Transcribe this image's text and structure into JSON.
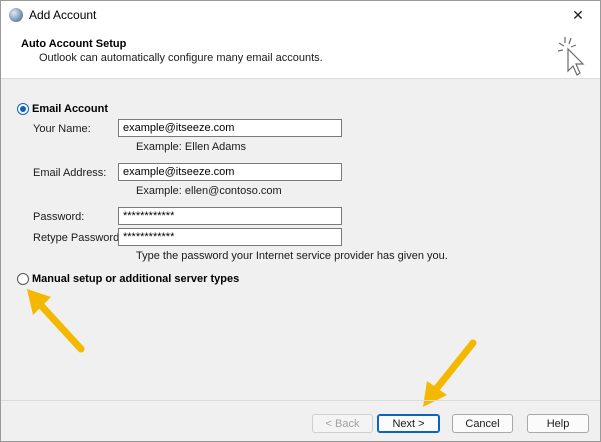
{
  "window": {
    "title": "Add Account",
    "close_glyph": "✕"
  },
  "header": {
    "title": "Auto Account Setup",
    "subtitle": "Outlook can automatically configure many email accounts."
  },
  "email_account": {
    "label": "Email Account",
    "selected": true,
    "your_name": {
      "label": "Your Name:",
      "value": "example@itseeze.com",
      "hint": "Example: Ellen Adams"
    },
    "email_address": {
      "label": "Email Address:",
      "value": "example@itseeze.com",
      "hint": "Example: ellen@contoso.com"
    },
    "password": {
      "label": "Password:",
      "value": "************"
    },
    "retype_password": {
      "label": "Retype Password:",
      "value": "************"
    },
    "password_hint": "Type the password your Internet service provider has given you."
  },
  "manual_setup": {
    "label": "Manual setup or additional server types",
    "selected": false
  },
  "buttons": {
    "back": "< Back",
    "next": "Next >",
    "cancel": "Cancel",
    "help": "Help"
  },
  "colors": {
    "accent": "#0a64c0",
    "arrow": "#f5b800"
  },
  "icons": [
    "app-icon",
    "close-icon",
    "wizard-icon",
    "arrow-annotation-icon"
  ]
}
